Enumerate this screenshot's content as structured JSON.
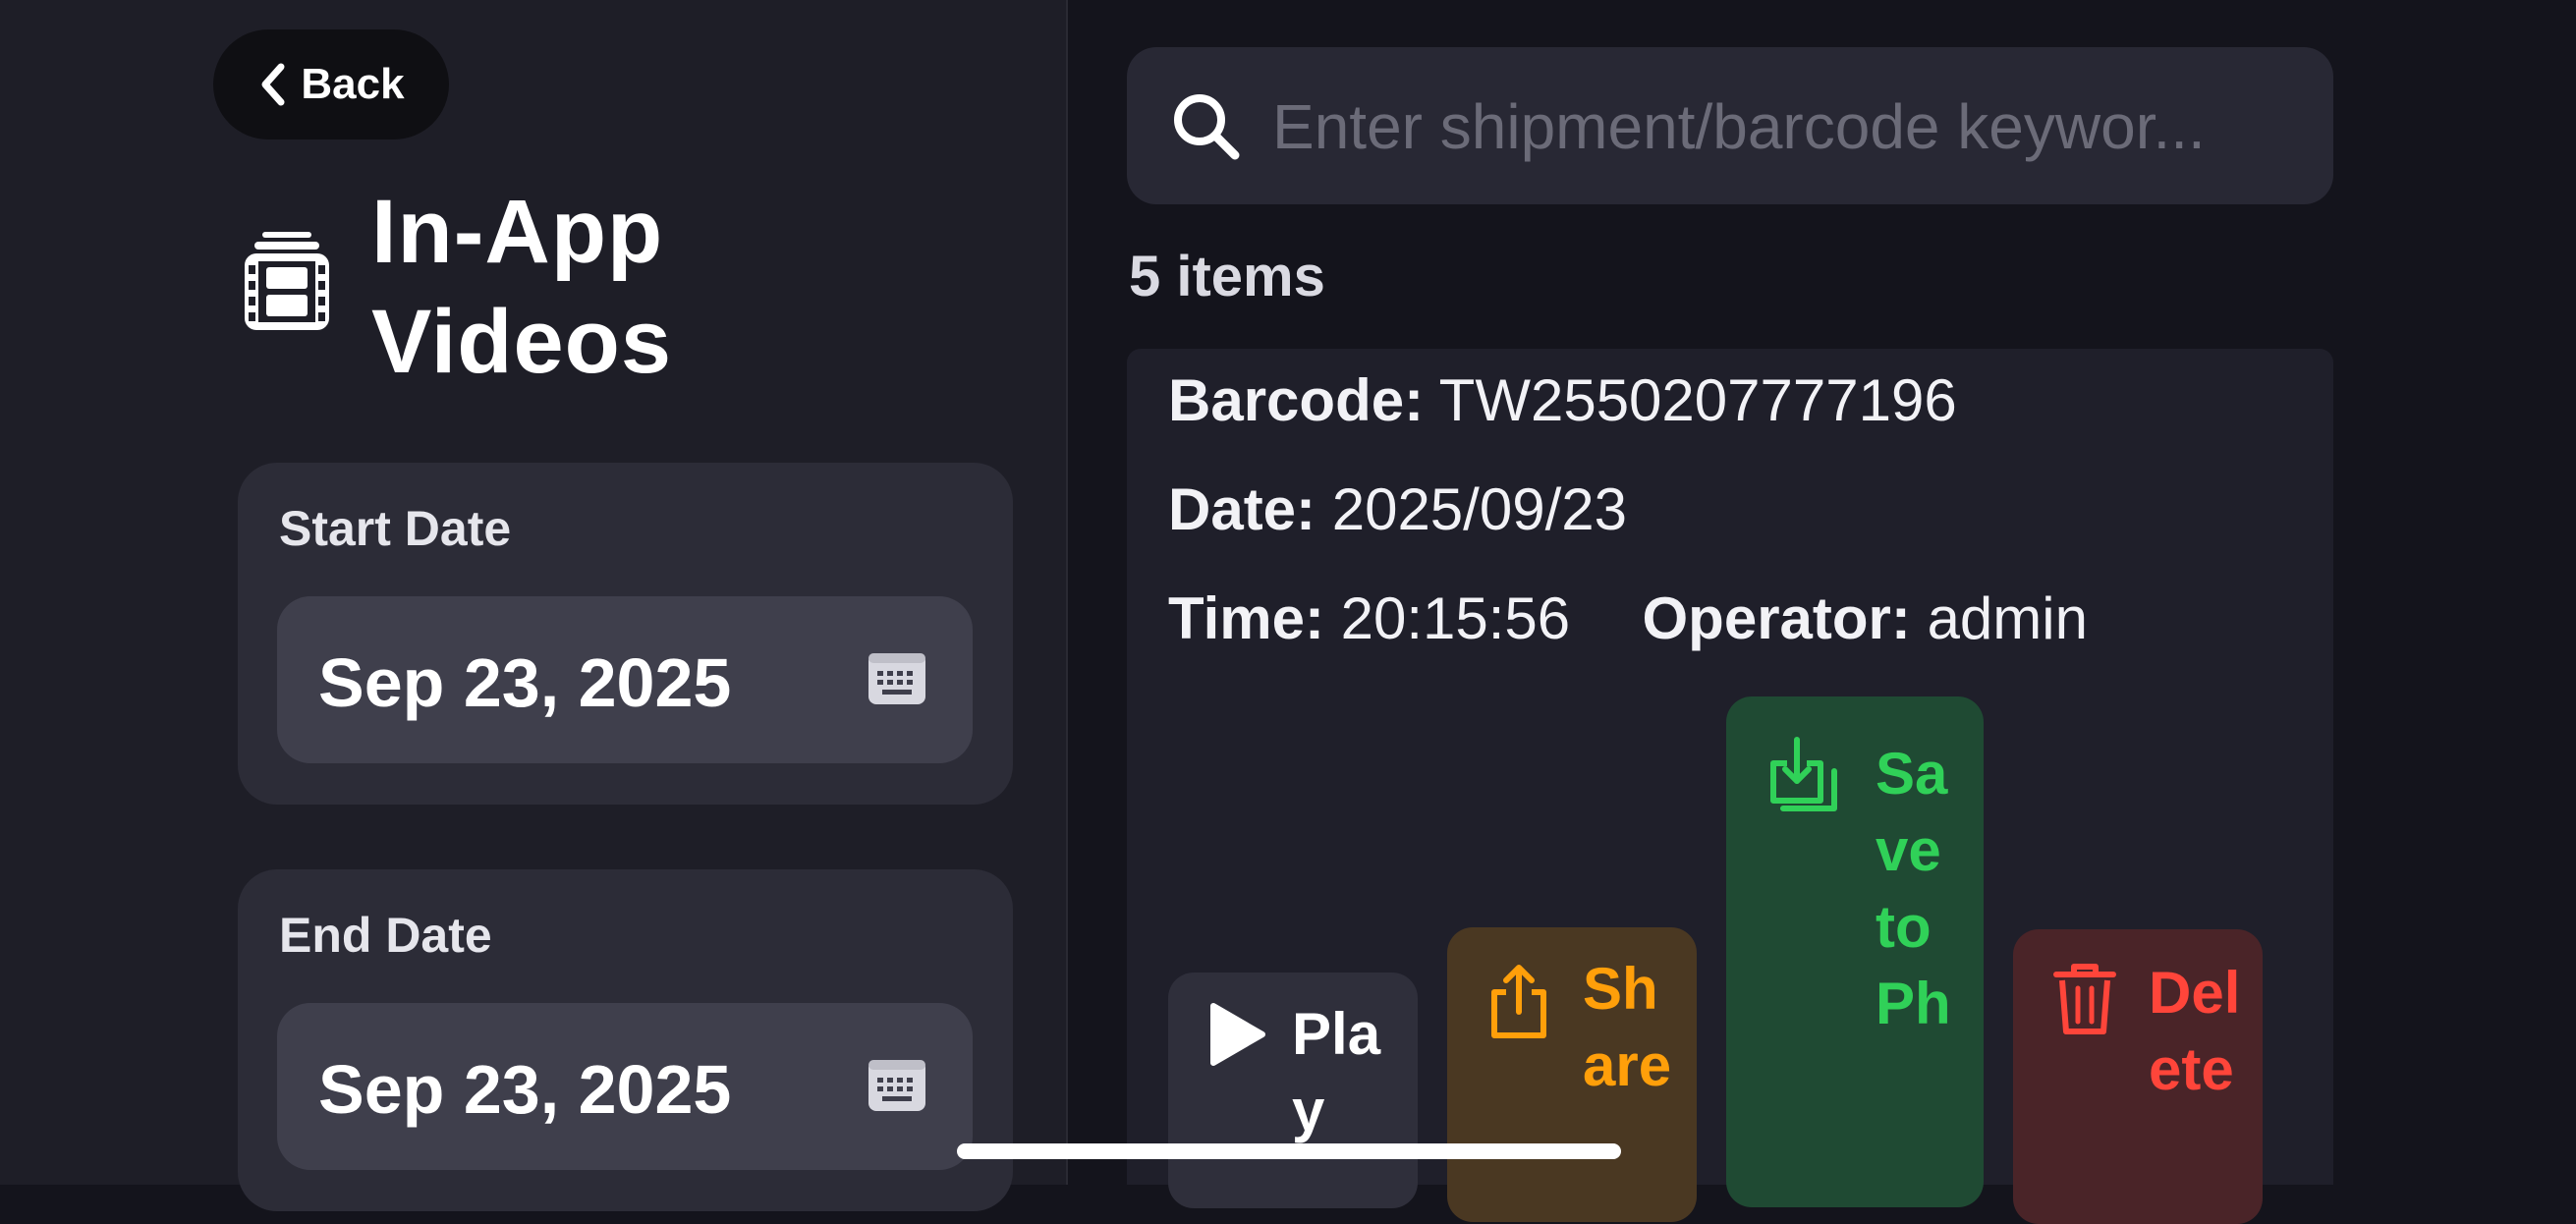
{
  "header": {
    "back_label": "Back",
    "title_line1": "In-App",
    "title_line2": "Videos"
  },
  "filters": {
    "start_label": "Start Date",
    "start_value": "Sep 23, 2025",
    "end_label": "End Date",
    "end_value": "Sep 23, 2025"
  },
  "search": {
    "placeholder": "Enter shipment/barcode keywor..."
  },
  "results": {
    "count_label": "5 items"
  },
  "item": {
    "barcode_label": "Barcode:",
    "barcode_value": "TW2550207777196",
    "date_label": "Date:",
    "date_value": "2025/09/23",
    "time_label": "Time:",
    "time_value": "20:15:56",
    "operator_label": "Operator:",
    "operator_value": "admin"
  },
  "actions": {
    "play_label": "Play",
    "share_label": "Share",
    "save_label": "Save to Ph",
    "delete_label": "Delete"
  },
  "colors": {
    "play_bg": "#2f2f3b",
    "share_bg": "#4a3822",
    "share_fg": "#ff9f0a",
    "save_bg": "#1f4a33",
    "save_fg": "#30d158",
    "delete_bg": "#4a2428",
    "delete_fg": "#ff453a"
  }
}
